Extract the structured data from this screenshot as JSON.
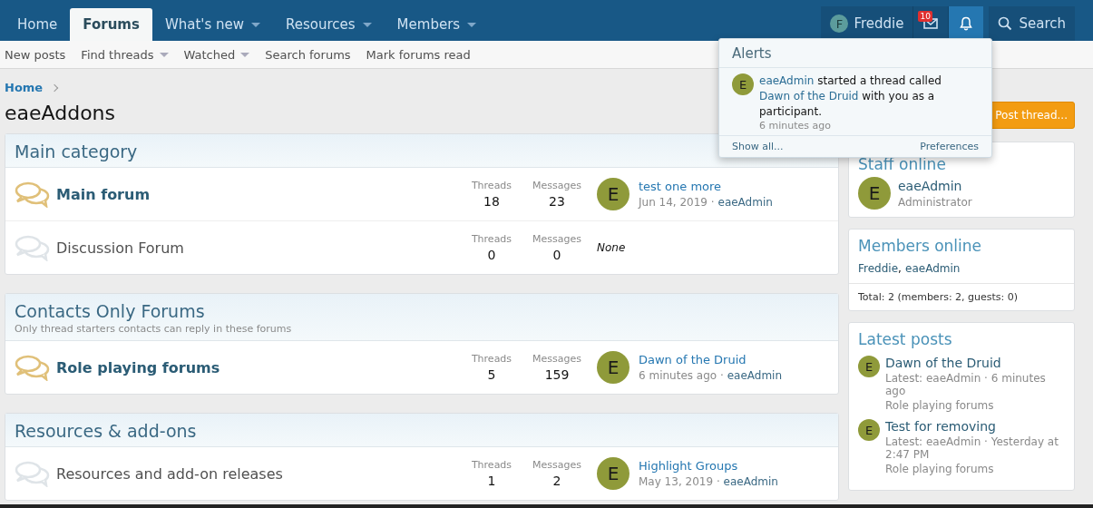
{
  "nav": {
    "tabs": [
      {
        "label": "Home",
        "selected": false,
        "dropdown": false
      },
      {
        "label": "Forums",
        "selected": true,
        "dropdown": false
      },
      {
        "label": "What's new",
        "selected": false,
        "dropdown": true
      },
      {
        "label": "Resources",
        "selected": false,
        "dropdown": true
      },
      {
        "label": "Members",
        "selected": false,
        "dropdown": true
      }
    ],
    "user": {
      "initial": "F",
      "name": "Freddie"
    },
    "inbox_badge": "10",
    "alerts_open": true,
    "search": "Search"
  },
  "subnav": [
    {
      "label": "New posts",
      "dropdown": false
    },
    {
      "label": "Find threads",
      "dropdown": true
    },
    {
      "label": "Watched",
      "dropdown": true
    },
    {
      "label": "Search forums",
      "dropdown": false
    },
    {
      "label": "Mark forums read",
      "dropdown": false
    }
  ],
  "breadcrumb": "Home",
  "page_title": "eaeAddons",
  "post_button": "Post thread...",
  "categories": [
    {
      "title": "Main category",
      "forums": [
        {
          "name": "Main forum",
          "unread": true,
          "threads_label": "Threads",
          "threads": "18",
          "messages_label": "Messages",
          "messages": "23",
          "latest": {
            "initial": "E",
            "title": "test one more",
            "date": "Jun 14, 2019",
            "sep": "·",
            "user": "eaeAdmin"
          }
        },
        {
          "name": "Discussion Forum",
          "unread": false,
          "threads_label": "Threads",
          "threads": "0",
          "messages_label": "Messages",
          "messages": "0",
          "none": "None"
        }
      ]
    },
    {
      "title": "Contacts Only Forums",
      "description": "Only thread starters contacts can reply in these forums",
      "forums": [
        {
          "name": "Role playing forums",
          "unread": true,
          "threads_label": "Threads",
          "threads": "5",
          "messages_label": "Messages",
          "messages": "159",
          "latest": {
            "initial": "E",
            "title": "Dawn of the Druid",
            "date": "6 minutes ago",
            "sep": "·",
            "user": "eaeAdmin"
          }
        }
      ]
    },
    {
      "title": "Resources & add-ons",
      "forums": [
        {
          "name": "Resources and add-on releases",
          "unread": false,
          "threads_label": "Threads",
          "threads": "1",
          "messages_label": "Messages",
          "messages": "2",
          "latest": {
            "initial": "E",
            "title": "Highlight Groups",
            "date": "May 13, 2019",
            "sep": "·",
            "user": "eaeAdmin"
          }
        }
      ]
    }
  ],
  "staff_online": {
    "title": "Staff online",
    "members": [
      {
        "initial": "E",
        "name": "eaeAdmin",
        "role": "Administrator"
      }
    ]
  },
  "members_online": {
    "title": "Members online",
    "names": [
      "Freddie",
      "eaeAdmin"
    ],
    "separator": ",",
    "total": "Total: 2 (members: 2, guests: 0)"
  },
  "latest_posts": {
    "title": "Latest posts",
    "posts": [
      {
        "initial": "E",
        "title": "Dawn of the Druid",
        "meta": "Latest: eaeAdmin · 6 minutes ago",
        "forum": "Role playing forums"
      },
      {
        "initial": "E",
        "title": "Test for removing",
        "meta": "Latest: eaeAdmin · Yesterday at 2:47 PM",
        "forum": "Role playing forums"
      }
    ]
  },
  "alerts": {
    "title": "Alerts",
    "items": [
      {
        "initial": "E",
        "user": "eaeAdmin",
        "thread": "Dawn of the Druid",
        "before": "started a thread called",
        "after": "with you as a participant.",
        "time": "6 minutes ago"
      }
    ],
    "show_all": "Show all...",
    "preferences": "Preferences"
  }
}
